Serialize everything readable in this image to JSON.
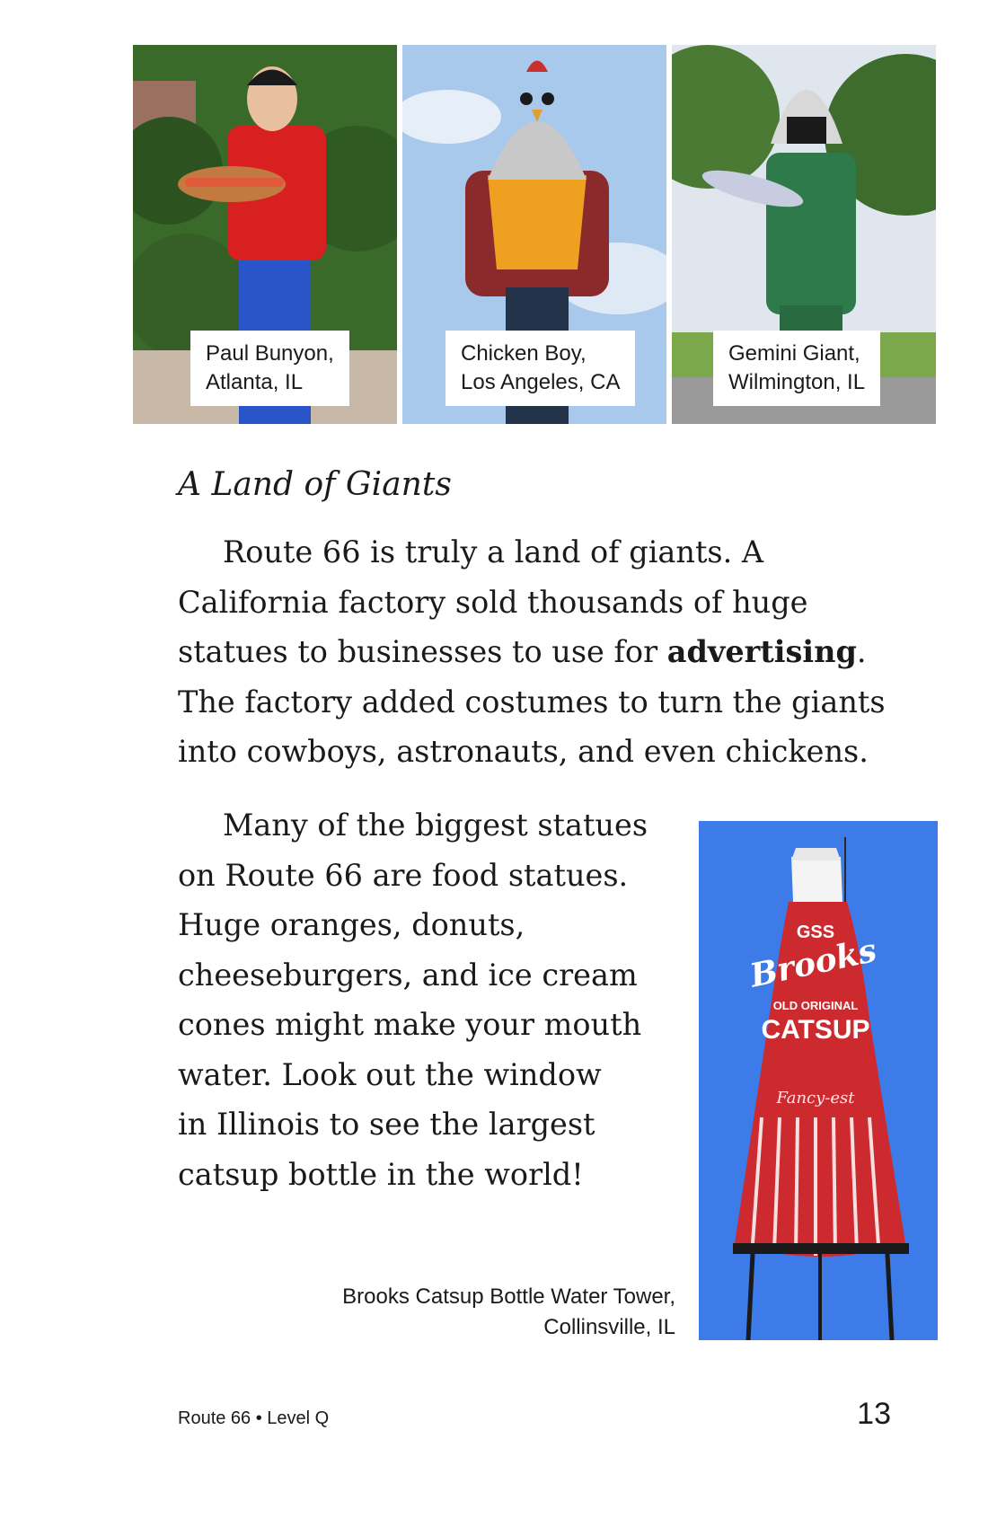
{
  "photos": [
    {
      "caption_line1": "Paul Bunyon,",
      "caption_line2": "Atlanta, IL",
      "subject": "hotdog-man-statue"
    },
    {
      "caption_line1": "Chicken Boy,",
      "caption_line2": "Los Angeles, CA",
      "subject": "chicken-boy-statue"
    },
    {
      "caption_line1": "Gemini Giant,",
      "caption_line2": "Wilmington, IL",
      "subject": "gemini-giant-statue"
    }
  ],
  "section_title": "A Land of Giants",
  "paragraph1": {
    "l1": "Route 66 is truly a land of giants. A",
    "l2": "California factory sold thousands of huge",
    "l3_before": "statues to businesses to use for ",
    "l3_bold": "advertising",
    "l3_after": ".",
    "l4": "The factory added costumes to turn the giants",
    "l5": "into cowboys, astronauts, and even chickens."
  },
  "paragraph2": [
    "Many of the biggest statues",
    "on Route 66 are food statues.",
    "Huge oranges, donuts,",
    "cheeseburgers, and ice cream",
    "cones might make your mouth",
    "water. Look out the window",
    "in Illinois to see the largest",
    "catsup bottle in the world!"
  ],
  "bottle_photo": {
    "caption_line1": "Brooks Catsup Bottle Water Tower,",
    "caption_line2": "Collinsville, IL",
    "label_logo": "GSS",
    "label_brand": "Brooks",
    "label_small": "OLD ORIGINAL",
    "label_main": "CATSUP",
    "label_script": "Fancy-est"
  },
  "footer": {
    "text": "Route 66 • Level Q",
    "page_number": "13"
  },
  "colors": {
    "sky_blue": "#3d7be8",
    "catsup_red": "#cc2a2e",
    "text": "#1a1a1a"
  }
}
